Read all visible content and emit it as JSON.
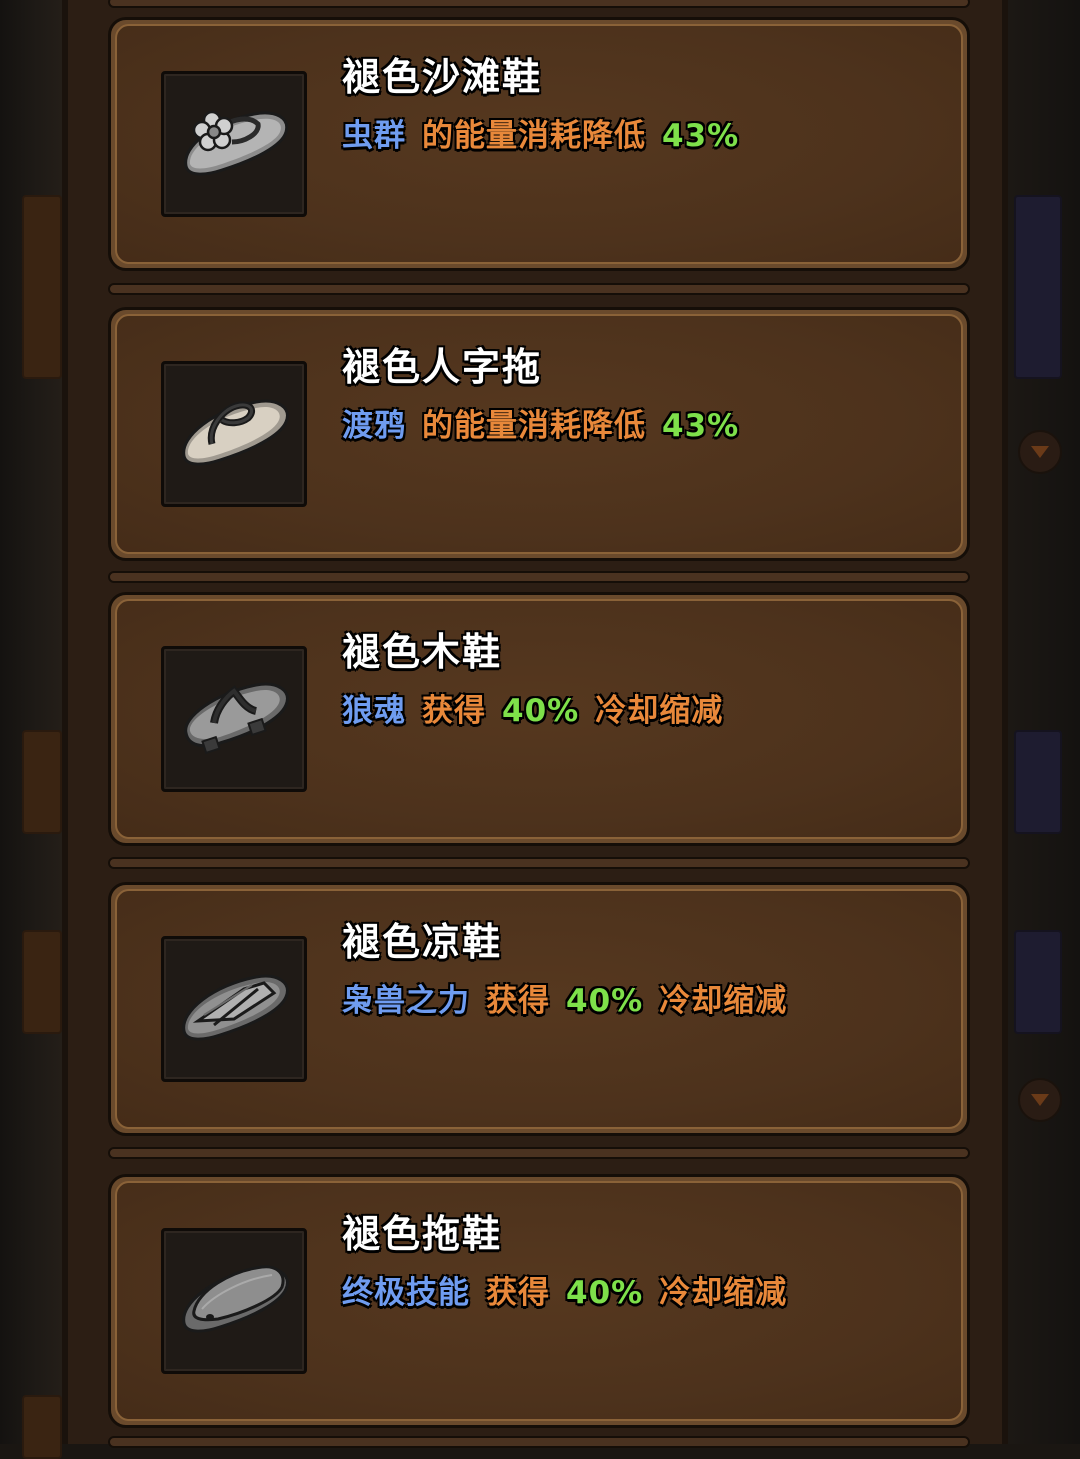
{
  "colors": {
    "skill": "#6f9cf0",
    "text": "#e8883a",
    "value": "#7ee04a",
    "title": "#ffffff"
  },
  "items": [
    {
      "icon": "flower-beach-sandal-icon",
      "title": "褪色沙滩鞋",
      "skill": "虫群",
      "effect": "的能量消耗降低",
      "value": "43%",
      "suffix": ""
    },
    {
      "icon": "flip-flop-icon",
      "title": "褪色人字拖",
      "skill": "渡鸦",
      "effect": "的能量消耗降低",
      "value": "43%",
      "suffix": ""
    },
    {
      "icon": "wooden-clog-icon",
      "title": "褪色木鞋",
      "skill": "狼魂",
      "effect": "获得",
      "value": "40%",
      "suffix": "冷却缩减"
    },
    {
      "icon": "strap-sandal-icon",
      "title": "褪色凉鞋",
      "skill": "枭兽之力",
      "effect": "获得",
      "value": "40%",
      "suffix": "冷却缩减"
    },
    {
      "icon": "slide-slipper-icon",
      "title": "褪色拖鞋",
      "skill": "终极技能",
      "effect": "获得",
      "value": "40%",
      "suffix": "冷却缩减"
    }
  ]
}
